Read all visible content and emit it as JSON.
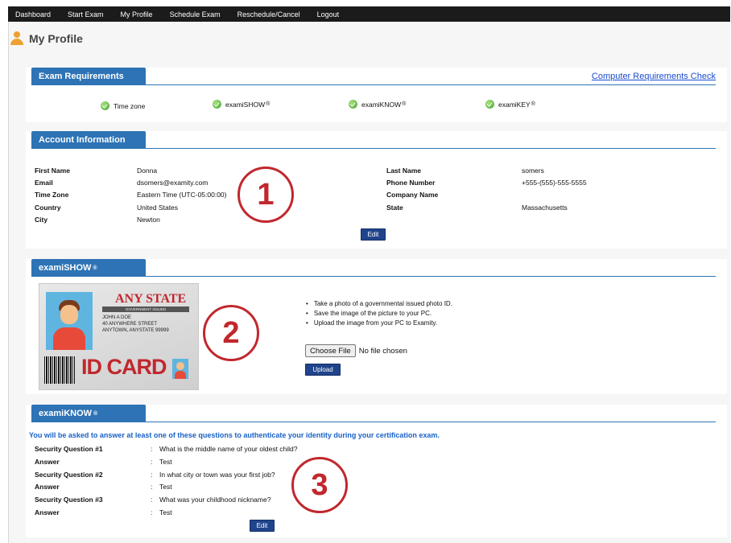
{
  "nav": [
    "Dashboard",
    "Start Exam",
    "My Profile",
    "Schedule Exam",
    "Reschedule/Cancel",
    "Logout"
  ],
  "page_title": "My Profile",
  "exam_requirements": {
    "tab": "Exam Requirements",
    "link": "Computer Requirements Check",
    "items": [
      {
        "label": "Time zone",
        "reg": ""
      },
      {
        "label": "examiSHOW",
        "reg": "®"
      },
      {
        "label": "examiKNOW",
        "reg": "®"
      },
      {
        "label": "examiKEY",
        "reg": "®"
      }
    ]
  },
  "account": {
    "tab": "Account Information",
    "left": [
      {
        "label": "First Name",
        "value": "Donna"
      },
      {
        "label": "Email",
        "value": "dsomers@examity.com"
      },
      {
        "label": "Time Zone",
        "value": "Eastern Time (UTC-05:00:00)"
      },
      {
        "label": "Country",
        "value": "United States"
      },
      {
        "label": "City",
        "value": "Newton"
      }
    ],
    "right": [
      {
        "label": "Last Name",
        "value": "somers"
      },
      {
        "label": "Phone Number",
        "value": "+555-(555)-555-5555"
      },
      {
        "label": "Company Name",
        "value": ""
      },
      {
        "label": "State",
        "value": "Massachusetts"
      }
    ],
    "edit_label": "Edit"
  },
  "examishow": {
    "tab": "examiSHOW",
    "reg": "®",
    "card": {
      "state": "ANY STATE",
      "issued": "GOVERNMENT ISSUED",
      "name": "JOHN A DOE",
      "street": "40 ANYWHERE STREET",
      "city": "ANYTOWN, ANYSTATE 99999",
      "id_text": "ID CARD"
    },
    "instructions": [
      "Take a photo of a governmental issued photo ID.",
      "Save the image of the picture to your PC.",
      "Upload the image from your PC to Examity."
    ],
    "choose_file": "Choose File",
    "no_file": "No file chosen",
    "upload_label": "Upload"
  },
  "examiknow": {
    "tab": "examiKNOW",
    "reg": "®",
    "notice": "You will be asked to answer at least one of these questions to authenticate your identity during your certification exam.",
    "rows": [
      {
        "label": "Security Question #1",
        "value": "What is the middle name of your oldest child?"
      },
      {
        "label": "Answer",
        "value": "Test"
      },
      {
        "label": "Security Question #2",
        "value": "In what city or town was your first job?"
      },
      {
        "label": "Answer",
        "value": "Test"
      },
      {
        "label": "Security Question #3",
        "value": "What was your childhood nickname?"
      },
      {
        "label": "Answer",
        "value": "Test"
      }
    ],
    "colon": ":",
    "edit_label": "Edit"
  },
  "badges": [
    "1",
    "2",
    "3"
  ],
  "colors": {
    "accent": "#2d73b5",
    "button": "#20448c",
    "badge": "#c1272d",
    "notice": "#1961c7",
    "link": "#1a4ad0"
  }
}
